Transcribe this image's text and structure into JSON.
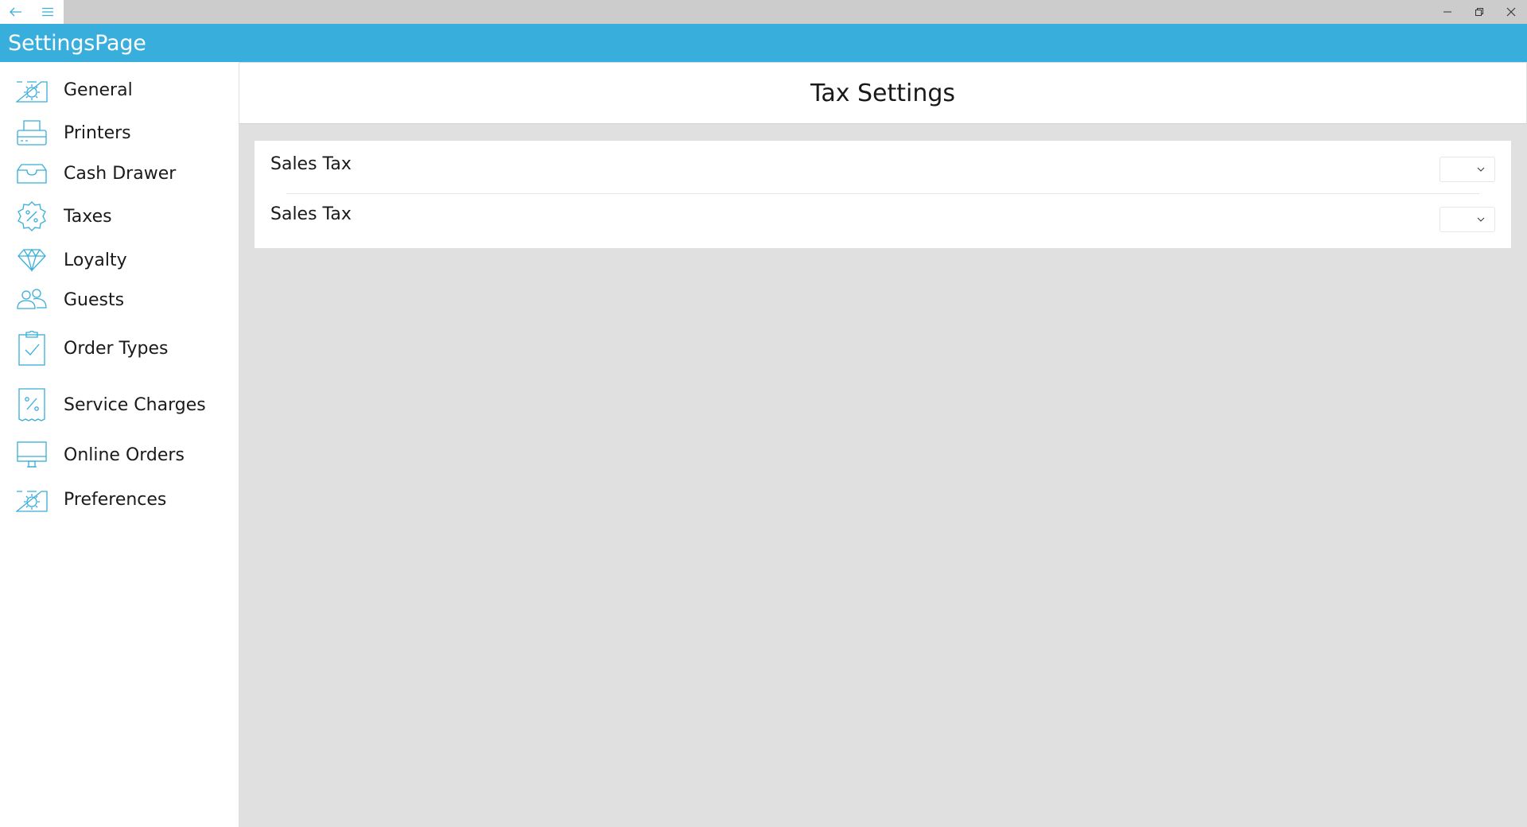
{
  "window": {
    "back_icon": "back-arrow-icon",
    "menu_icon": "hamburger-icon",
    "controls": [
      "minimize-icon",
      "restore-icon",
      "close-icon"
    ]
  },
  "app": {
    "title": "SettingsPage",
    "accent_color": "#37aedb"
  },
  "sidebar": {
    "items": [
      {
        "label": "General",
        "icon": "gear-window-icon"
      },
      {
        "label": "Printers",
        "icon": "printer-icon"
      },
      {
        "label": "Cash Drawer",
        "icon": "cash-drawer-icon"
      },
      {
        "label": "Taxes",
        "icon": "percent-badge-icon"
      },
      {
        "label": "Loyalty",
        "icon": "diamond-icon"
      },
      {
        "label": "Guests",
        "icon": "guests-icon"
      },
      {
        "label": "Order Types",
        "icon": "clipboard-check-icon"
      },
      {
        "label": "Service Charges",
        "icon": "percent-receipt-icon"
      },
      {
        "label": "Online Orders",
        "icon": "monitor-icon"
      },
      {
        "label": "Preferences",
        "icon": "gear-window-icon"
      }
    ]
  },
  "main": {
    "title": "Tax Settings",
    "rows": [
      {
        "label": "Sales Tax",
        "value": ""
      },
      {
        "label": "Sales Tax",
        "value": ""
      }
    ]
  }
}
